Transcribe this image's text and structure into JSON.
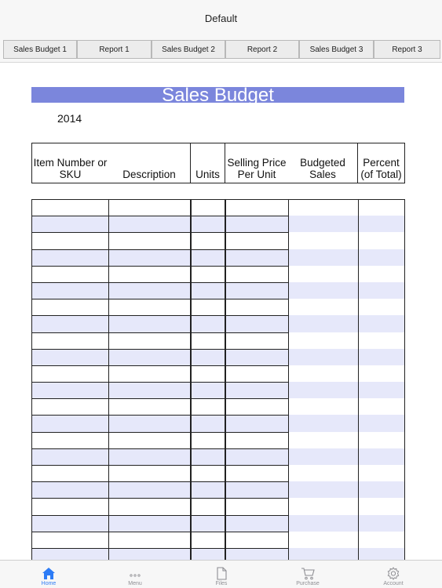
{
  "window": {
    "title": "Default"
  },
  "tabs": [
    {
      "label": "Sales Budget 1"
    },
    {
      "label": "Report 1"
    },
    {
      "label": "Sales Budget 2"
    },
    {
      "label": "Report 2"
    },
    {
      "label": "Sales Budget 3"
    },
    {
      "label": "Report 3"
    }
  ],
  "sheet": {
    "title": "Sales Budget",
    "year": "2014",
    "columns": [
      {
        "label": "Item Number or SKU"
      },
      {
        "label": "Description"
      },
      {
        "label": "Units"
      },
      {
        "label": "Selling Price Per Unit"
      },
      {
        "label": "Budgeted Sales"
      },
      {
        "label": "Percent (of Total)"
      }
    ]
  },
  "colors": {
    "banner": "#7b86dc",
    "row_stripe": "#e6e8fa",
    "row_plain": "#ffffff",
    "grid_line": "#222222",
    "active_tab": "#2d7cf6"
  },
  "bottom_nav": [
    {
      "label": "Home",
      "icon": "home-icon",
      "active": true
    },
    {
      "label": "Menu",
      "icon": "dots-icon",
      "active": false
    },
    {
      "label": "Files",
      "icon": "file-icon",
      "active": false
    },
    {
      "label": "Purchase",
      "icon": "cart-icon",
      "active": false
    },
    {
      "label": "Account",
      "icon": "gear-icon",
      "active": false
    }
  ]
}
